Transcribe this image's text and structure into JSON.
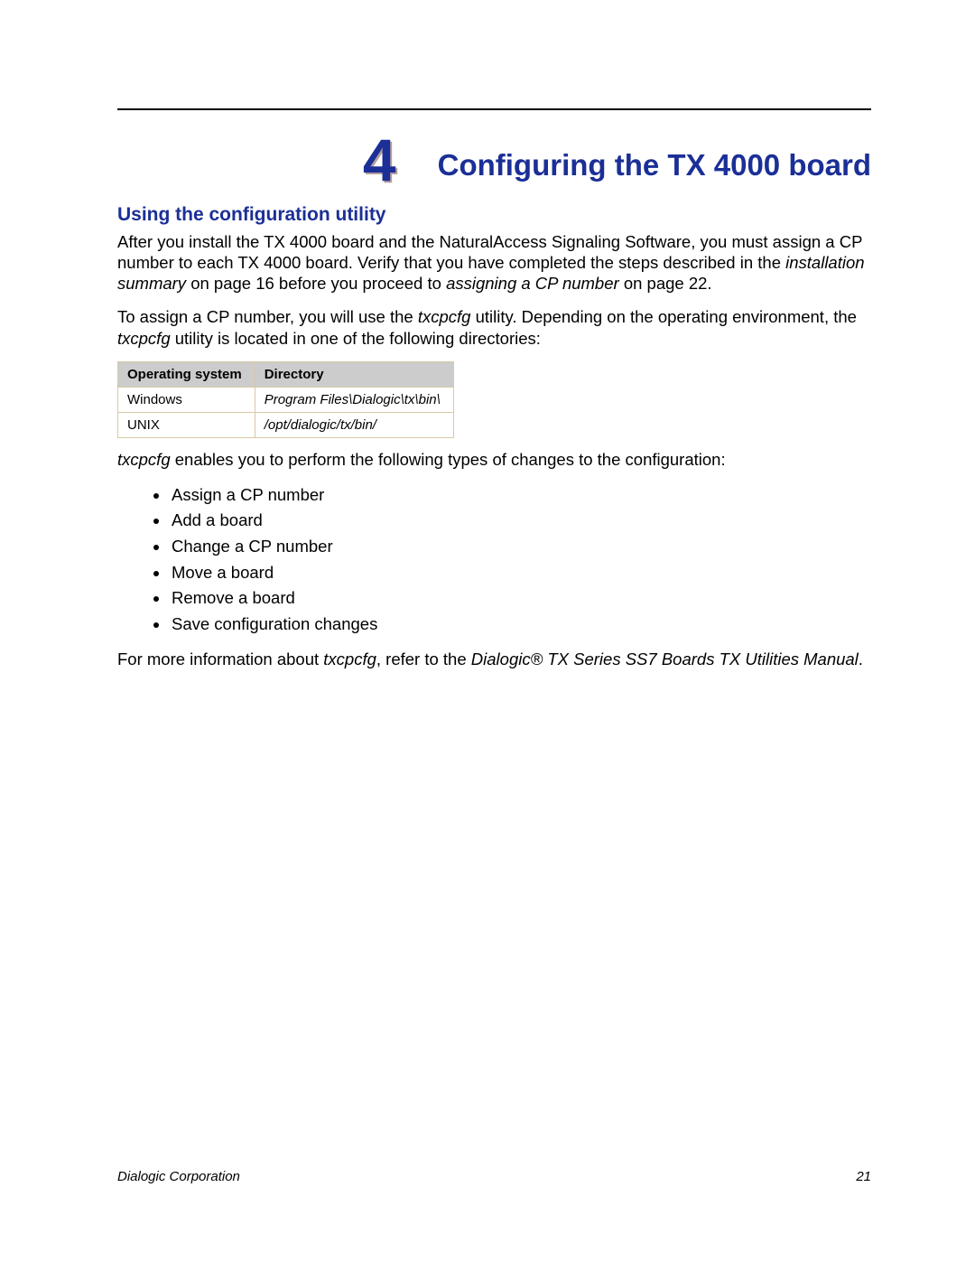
{
  "chapter": {
    "number": "4",
    "title": "Configuring the TX 4000 board"
  },
  "section": {
    "heading": "Using the configuration utility"
  },
  "para1": {
    "a": "After you install the TX 4000 board and the NaturalAccess Signaling Software, you must assign a CP number to each TX 4000 board. Verify that you have completed the steps described in the ",
    "b": "installation summary",
    "c": " on page 16 before you proceed to ",
    "d": "assigning a CP number",
    "e": " on page 22."
  },
  "para2": {
    "a": "To assign a CP number, you will use the ",
    "b": "txcpcfg",
    "c": " utility. Depending on the operating environment, the ",
    "d": "txcpcfg",
    "e": " utility is located in one of the following directories:"
  },
  "table": {
    "headers": {
      "os": "Operating system",
      "dir": "Directory"
    },
    "rows": [
      {
        "os": "Windows",
        "dir": "Program Files\\Dialogic\\tx\\bin\\"
      },
      {
        "os": "UNIX",
        "dir": "/opt/dialogic/tx/bin/"
      }
    ]
  },
  "para3": {
    "a": "txcpcfg",
    "b": " enables you to perform the following types of changes to the configuration:"
  },
  "changes": [
    "Assign a CP number",
    "Add a board",
    "Change a CP number",
    "Move a board",
    "Remove a board",
    "Save configuration changes"
  ],
  "para4": {
    "a": "For more information about ",
    "b": "txcpcfg",
    "c": ", refer to the ",
    "d": "Dialogic® TX Series SS7 Boards TX Utilities Manual",
    "e": "."
  },
  "footer": {
    "corp": "Dialogic Corporation",
    "page": "21"
  }
}
